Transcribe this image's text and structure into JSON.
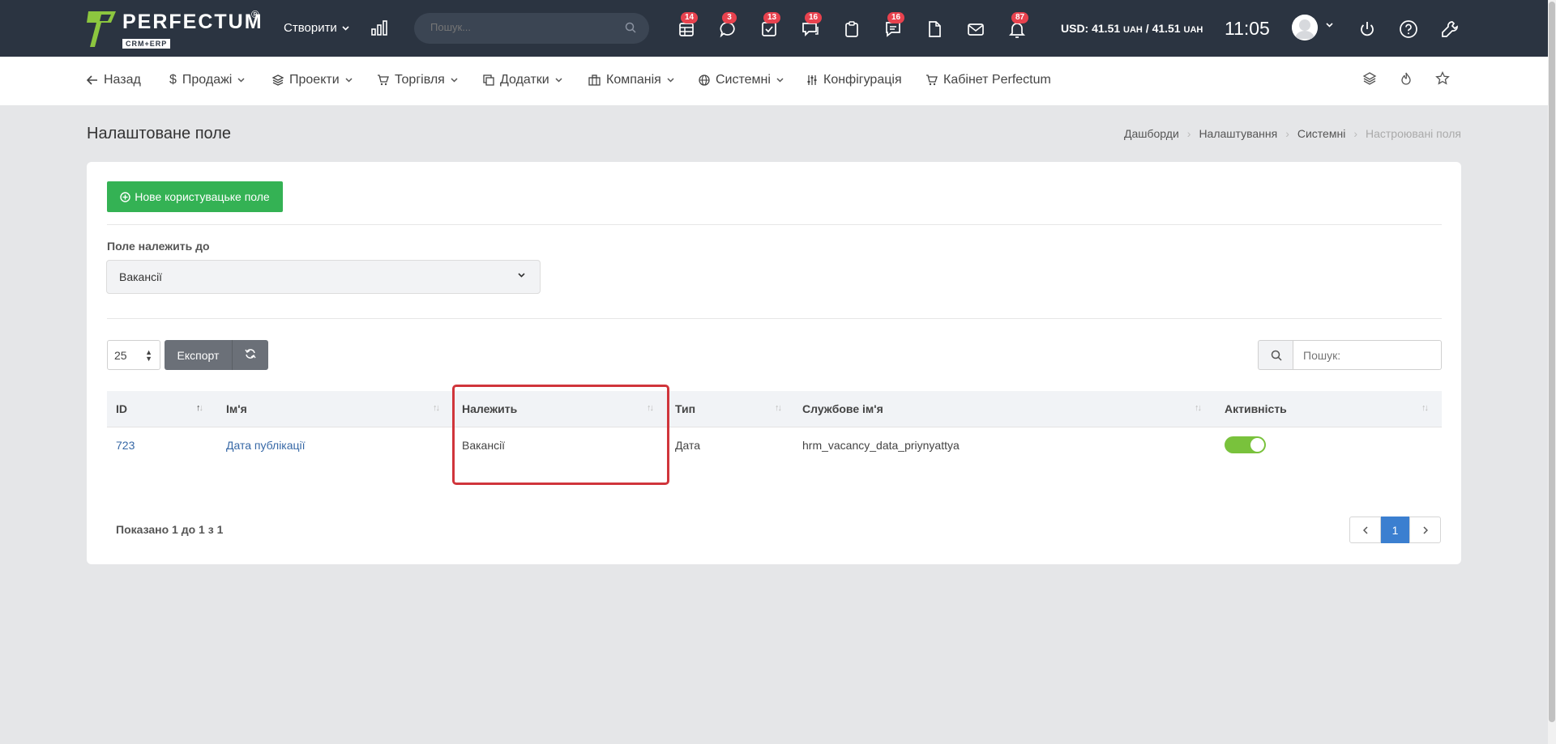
{
  "header": {
    "logo_text": "PERFECTUM",
    "logo_sub": "CRM+ERP",
    "logo_reg": "®",
    "create_label": "Створити",
    "search_placeholder": "Пошук...",
    "icons": [
      {
        "name": "table-icon",
        "badge": "14"
      },
      {
        "name": "chat-icon",
        "badge": "3"
      },
      {
        "name": "task-check-icon",
        "badge": "13"
      },
      {
        "name": "comments-icon",
        "badge": "16"
      },
      {
        "name": "clipboard-icon",
        "badge": ""
      },
      {
        "name": "messages-icon",
        "badge": "16"
      },
      {
        "name": "document-icon",
        "badge": ""
      },
      {
        "name": "mail-icon",
        "badge": ""
      },
      {
        "name": "bell-icon",
        "badge": "87"
      }
    ],
    "currency_label": "USD: 41.51",
    "currency_unit": "UAH",
    "currency_sep": " / ",
    "currency_label2": "41.51",
    "time": "11:05"
  },
  "nav": {
    "items": [
      {
        "label": "Назад",
        "icon": "arrow-left-icon"
      },
      {
        "label": "Продажі",
        "icon": "dollar-icon"
      },
      {
        "label": "Проекти",
        "icon": "layers-icon"
      },
      {
        "label": "Торгівля",
        "icon": "cart-icon"
      },
      {
        "label": "Додатки",
        "icon": "copy-icon"
      },
      {
        "label": "Компанія",
        "icon": "building-icon"
      },
      {
        "label": "Системні",
        "icon": "globe-icon"
      },
      {
        "label": "Конфігурація",
        "icon": "sliders-icon"
      },
      {
        "label": "Кабінет Perfectum",
        "icon": "cart-icon"
      }
    ]
  },
  "page": {
    "title": "Налаштоване поле",
    "breadcrumb": [
      "Дашборди",
      "Налаштування",
      "Системні",
      "Настроювані поля"
    ]
  },
  "form": {
    "new_button": "Нове користувацьке поле",
    "belongs_label": "Поле належить до",
    "belongs_value": "Вакансії"
  },
  "table_controls": {
    "per_page": "25",
    "export_label": "Експорт",
    "search_placeholder": "Пошук:"
  },
  "table": {
    "columns": [
      "ID",
      "Ім'я",
      "Належить",
      "Тип",
      "Службове ім'я",
      "Активність"
    ],
    "rows": [
      {
        "id": "723",
        "name": "Дата публікації",
        "belongs": "Вакансії",
        "type": "Дата",
        "service_name": "hrm_vacancy_data_priynyattya",
        "active": true
      }
    ]
  },
  "footer": {
    "shown_text": "Показано 1 до 1 з 1",
    "pages": [
      "1"
    ]
  },
  "colors": {
    "topbar": "#2b3441",
    "green": "#34b254",
    "toggle_on": "#79c23c",
    "highlight": "#d0353b",
    "page_active": "#3b7fd0"
  }
}
